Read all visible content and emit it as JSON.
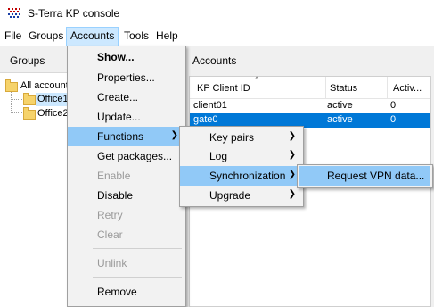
{
  "window": {
    "title": "S-Terra KP console"
  },
  "menubar": {
    "items": [
      "File",
      "Groups",
      "Accounts",
      "Tools",
      "Help"
    ]
  },
  "groups_pane": {
    "header": "Groups",
    "tree": [
      "All account",
      "Office1",
      "Office2"
    ]
  },
  "accounts_pane": {
    "header": "Accounts",
    "columns": [
      "KP Client ID",
      "Status",
      "Activ..."
    ],
    "rows": [
      {
        "id": "client01",
        "status": "active",
        "active": "0",
        "selected": false
      },
      {
        "id": "gate0",
        "status": "active",
        "active": "0",
        "selected": true
      }
    ]
  },
  "accounts_menu": {
    "items": [
      {
        "label": "Show...",
        "bold": true,
        "enabled": true
      },
      {
        "label": "Properties...",
        "enabled": true
      },
      {
        "label": "Create...",
        "enabled": true
      },
      {
        "label": "Update...",
        "enabled": true
      },
      {
        "label": "Functions",
        "enabled": true,
        "submenu": true
      },
      {
        "label": "Get packages...",
        "enabled": true
      },
      {
        "label": "Enable",
        "enabled": false
      },
      {
        "label": "Disable",
        "enabled": true
      },
      {
        "label": "Retry",
        "enabled": false
      },
      {
        "label": "Clear",
        "enabled": false
      },
      {
        "label": "Unlink",
        "enabled": false
      },
      {
        "label": "Remove",
        "enabled": true
      }
    ]
  },
  "functions_menu": {
    "items": [
      "Key pairs",
      "Log",
      "Synchronization",
      "Upgrade"
    ]
  },
  "synchronization_menu": {
    "items": [
      "Request VPN data..."
    ]
  },
  "colors": {
    "highlight": "#91c9f7",
    "selection": "#0078d7",
    "menu_bg": "#f2f2f2"
  }
}
